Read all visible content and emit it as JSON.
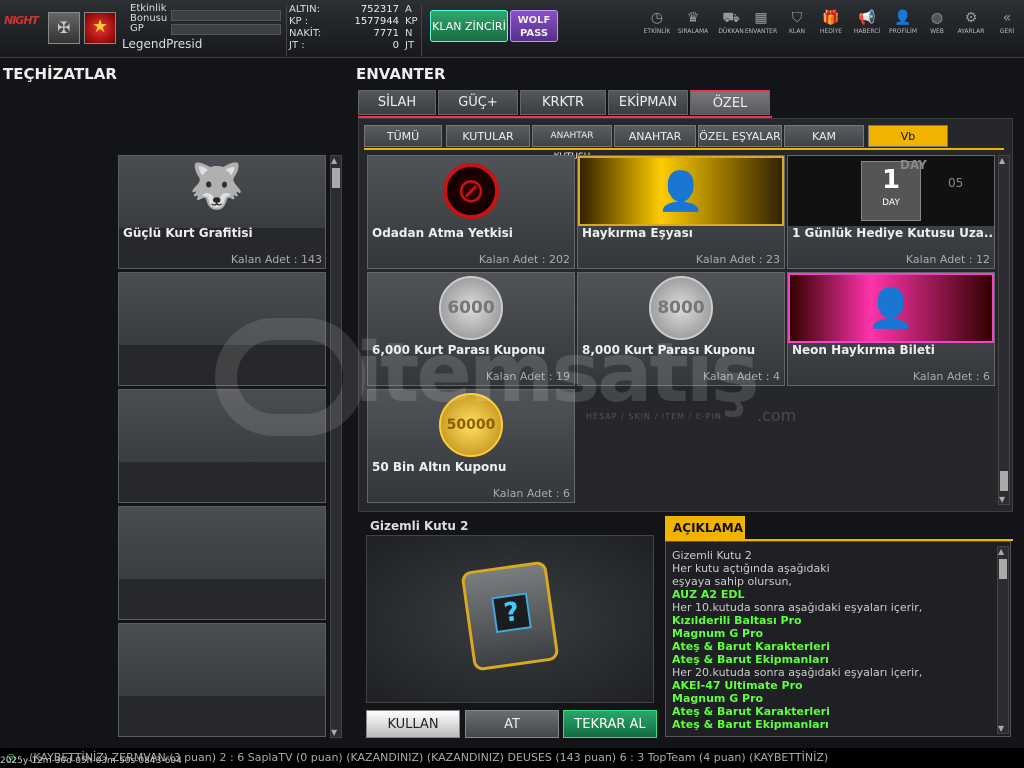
{
  "header": {
    "logo_text": "NIGHT",
    "etkinlik_label": "Etkinlik Bonusu",
    "gp_label": "GP",
    "player_name": "LegendPresid",
    "currencies": [
      {
        "label": "ALTIN:",
        "value": "752317",
        "unit": "A"
      },
      {
        "label": "KP :",
        "value": "1577944",
        "unit": "KP"
      },
      {
        "label": "NAKİT:",
        "value": "7771",
        "unit": "N"
      },
      {
        "label": "JT :",
        "value": "0",
        "unit": "JT"
      }
    ],
    "klan_button": "KLAN ZİNCİRİ",
    "wolf_button": "WOLF PASS",
    "nav": [
      {
        "label": "ETKİNLİK",
        "icon": "clock-icon",
        "glyph": "◷"
      },
      {
        "label": "SIRALAMA",
        "icon": "ranking-icon",
        "glyph": "♛"
      },
      {
        "label": "DÜKKAN",
        "icon": "cart-icon",
        "glyph": "⛟"
      },
      {
        "label": "ENVANTER",
        "icon": "inventory-icon",
        "glyph": "▦"
      },
      {
        "label": "KLAN",
        "icon": "shield-icon",
        "glyph": "⛉"
      },
      {
        "label": "HEDİYE",
        "icon": "gift-icon",
        "glyph": "🎁"
      },
      {
        "label": "HABERCİ",
        "icon": "megaphone-icon",
        "glyph": "📢"
      },
      {
        "label": "PROFİLİM",
        "icon": "profile-icon",
        "glyph": "👤"
      },
      {
        "label": "WEB",
        "icon": "globe-icon",
        "glyph": "◍"
      },
      {
        "label": "AYARLAR",
        "icon": "gear-icon",
        "glyph": "⚙"
      },
      {
        "label": "GERİ",
        "icon": "back-icon",
        "glyph": "«"
      }
    ]
  },
  "left_panel": {
    "title": "TEÇHİZATLAR",
    "slot1_name": "Güçlü Kurt Grafitisi",
    "slot1_count": "Kalan Adet : 143"
  },
  "inventory": {
    "title": "ENVANTER",
    "tabs": [
      "SİLAH",
      "GÜÇ+",
      "KRKTR",
      "EKİPMAN",
      "ÖZEL"
    ],
    "subtabs": [
      "TÜMÜ",
      "KUTULAR",
      "ANAHTAR KUTUSU",
      "ANAHTAR",
      "ÖZEL EŞYALAR",
      "KAM",
      "Vb"
    ],
    "items": [
      {
        "name": "Odadan Atma Yetkisi",
        "count": "Kalan Adet : 202"
      },
      {
        "name": "Haykırma Eşyası",
        "count": "Kalan Adet : 23"
      },
      {
        "name": "1 Günlük Hediye Kutusu Uza...",
        "count": "Kalan Adet : 12",
        "day_top": "DAY",
        "day_num": "1",
        "day_label": "DAY",
        "day_side": "05"
      },
      {
        "name": "6,000 Kurt Parası Kuponu",
        "count": "Kalan Adet : 19",
        "coin": "6000"
      },
      {
        "name": "8,000 Kurt Parası Kuponu",
        "count": "Kalan Adet : 4",
        "coin": "8000"
      },
      {
        "name": "Neon Haykırma Bileti",
        "count": "Kalan Adet : 6"
      },
      {
        "name": "50 Bin Altın Kuponu",
        "count": "Kalan Adet : 6",
        "coin": "50000"
      }
    ]
  },
  "detail": {
    "title": "Gizemli Kutu 2",
    "buttons": {
      "use": "KULLAN",
      "drop": "AT",
      "rebuy": "TEKRAR AL"
    },
    "desc_header": "AÇIKLAMA",
    "desc_lines": [
      {
        "text": "Gizemli Kutu 2",
        "style": "w"
      },
      {
        "text": "Her kutu açtığında aşağıdaki",
        "style": "w"
      },
      {
        "text": "eşyaya sahip olursun,",
        "style": "w"
      },
      {
        "text": "AUZ A2 EDL",
        "style": "g"
      },
      {
        "text": "Her 10.kutuda sonra aşağıdaki eşyaları içerir,",
        "style": "w"
      },
      {
        "text": "Kızılderili Baltası Pro",
        "style": "g"
      },
      {
        "text": "Magnum G Pro",
        "style": "g"
      },
      {
        "text": "Ateş & Barut Karakterleri",
        "style": "g"
      },
      {
        "text": "Ateş & Barut Ekipmanları",
        "style": "g"
      },
      {
        "text": "Her 20.kutuda sonra aşağıdaki eşyaları içerir,",
        "style": "w"
      },
      {
        "text": "AKEI-47 Ultimate Pro",
        "style": "g"
      },
      {
        "text": "Magnum G Pro",
        "style": "g"
      },
      {
        "text": "Ateş & Barut Karakterleri",
        "style": "g"
      },
      {
        "text": "Ateş & Barut Ekipmanları",
        "style": "g"
      }
    ]
  },
  "footer": {
    "ticker": "(KAYBETTİNİZ) ZERMVAN (3 puan) 2 : 6 SaplaTV (0 puan) (KAZANDINIZ)          (KAZANDINIZ) DEUSES (143 puan) 6 : 3 TopTeam (4 puan) (KAYBETTİNİZ)",
    "timestamp": "2025y-12m-30d-05h-03m-50s-0843-694"
  },
  "watermark": {
    "text": "itemsatış",
    "sub": "HESAP / SKIN / ITEM / E-PIN",
    "com": ".com"
  }
}
